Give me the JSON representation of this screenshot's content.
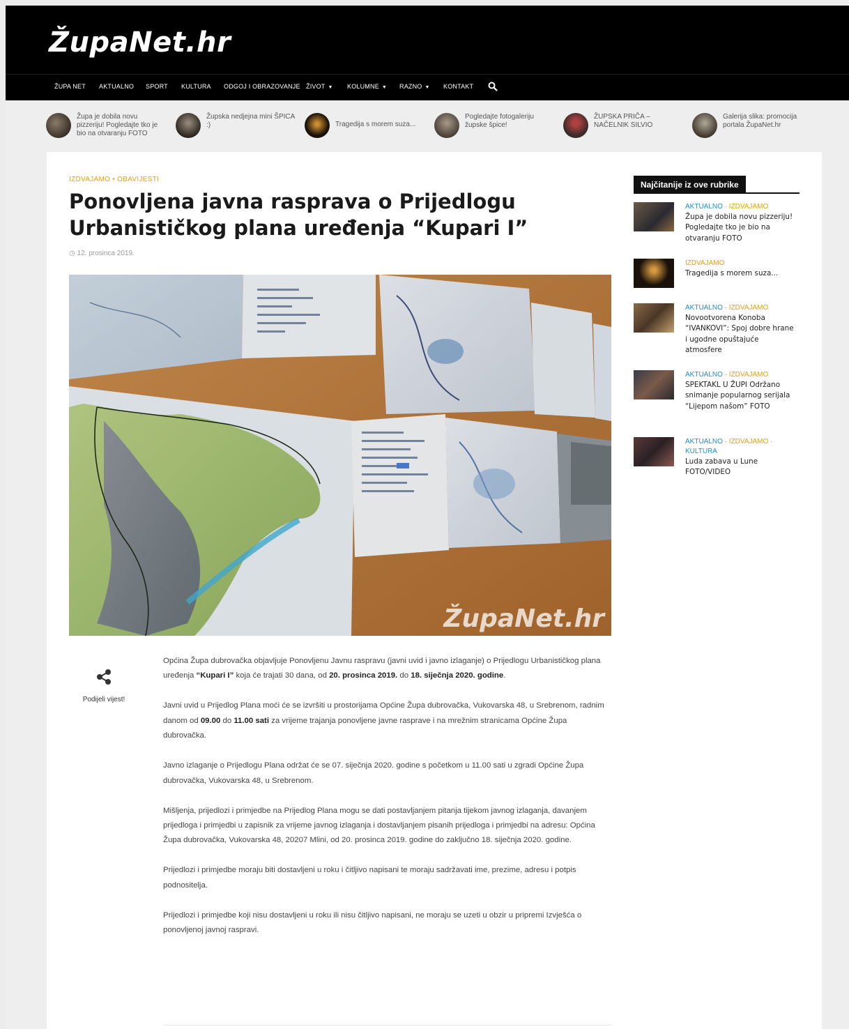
{
  "site": {
    "logo": "ŽupaNet.hr"
  },
  "nav": {
    "items": [
      {
        "label": "ŽUPA NET"
      },
      {
        "label": "AKTUALNO"
      },
      {
        "label": "SPORT"
      },
      {
        "label": "KULTURA"
      },
      {
        "label": "ODGOJ I OBRAZOVANJE"
      },
      {
        "label": "ŽIVOT"
      },
      {
        "label": "KOLUMNE"
      },
      {
        "label": "RAZNO"
      },
      {
        "label": "KONTAKT"
      }
    ]
  },
  "ticker": [
    {
      "text": "Župa je dobila novu pizzeriju! Pogledajte tko je bio na otvaranju FOTO"
    },
    {
      "text": "Župska nedjejna mini ŠPICA :)"
    },
    {
      "text": "Tragedija s morem suza..."
    },
    {
      "text": "Pogledajte fotogaleriju župske špice!"
    },
    {
      "text": "ŽUPSKA PRIČA – NAČELNIK SILVIO"
    },
    {
      "text": "Galerija slika: promocija portala ŽupaNet.hr"
    }
  ],
  "article": {
    "categories": "IZDVAJAMO • OBAVIJESTI",
    "title": "Ponovljena javna rasprava o Prijedlogu Urbanističkog plana uređenja “Kupari I”",
    "date": "12. prosinca 2019.",
    "watermark": "ŽupaNet.hr",
    "share_label": "Podijeli vijest!",
    "p1": {
      "a": "Općina Župa dubrovačka objavljuje Ponovljenu Javnu raspravu (javni uvid i javno izlaganje) o Prijedlogu Urbanističkog plana uređenja ",
      "b": "“Kupari I”",
      "c": " koja će trajati 30 dana, od ",
      "d": "20. prosinca 2019.",
      "e": " do ",
      "f": "18. siječnja 2020. godine",
      "g": "."
    },
    "p2": {
      "a": "Javni uvid u Prijedlog Plana moći će se izvršiti u prostorijama Općine Župa dubrovačka, Vukovarska 48, u Srebrenom, radnim danom od ",
      "b": "09.00",
      "c": " do ",
      "d": "11.00 sati",
      "e": " za vrijeme trajanja ponovljene javne rasprave i na mrežnim stranicama Općine Župa dubrovačka."
    },
    "p3": "Javno izlaganje o Prijedlogu Plana održat će se 07. siječnja 2020. godine s početkom u 11.00 sati u zgradi Općine Župa dubrovačka, Vukovarska 48, u Srebrenom.",
    "p4": "Mišljenja, prijedlozi i primjedbe na Prijedlog Plana mogu se dati postavljanjem pitanja tijekom javnog izlaganja, davanjem prijedloga i primjedbi u zapisnik za vrijeme javnog izlaganja i dostavljanjem pisanih prijedloga i primjedbi na adresu: Općina Župa dubrovačka, Vukovarska 48, 20207 Mlini, od 20. prosinca 2019. godine do zaključno 18. siječnja 2020. godine.",
    "p5": "Prijedlozi i primjedbe moraju biti dostavljeni u roku i čitljivo napisani te moraju sadržavati ime, prezime, adresu i potpis podnositelja.",
    "p6": "Prijedlozi i primjedbe koji nisu dostavljeni u roku ili nisu čitljivo napisani, ne moraju se uzeti u obzir u pripremi Izvješća o ponovljenoj javnoj raspravi."
  },
  "sidebar": {
    "heading": "Najčitanije iz ove rubrike",
    "items": [
      {
        "cat1": "AKTUALNO",
        "cat2": "IZDVAJAMO",
        "cat3": "",
        "title": "Župa je dobila novu pizzeriju! Pogledajte tko je bio na otvaranju FOTO"
      },
      {
        "cat1": "",
        "cat2": "IZDVAJAMO",
        "cat3": "",
        "title": "Tragedija s morem suza..."
      },
      {
        "cat1": "AKTUALNO",
        "cat2": "IZDVAJAMO",
        "cat3": "",
        "title": "Novootvorena Konoba “IVANKOVI”: Spoj dobre hrane i ugodne opuštajuće atmosfere"
      },
      {
        "cat1": "AKTUALNO",
        "cat2": "IZDVAJAMO",
        "cat3": "",
        "title": "SPEKTAKL U ŽUPI Održano snimanje popularnog serijala “Lijepom našom” FOTO"
      },
      {
        "cat1": "AKTUALNO",
        "cat2": "IZDVAJAMO",
        "cat3": "KULTURA",
        "title": "Luda zabava u Lune FOTO/VIDEO"
      }
    ]
  },
  "colors": {
    "accent": "#e8a100",
    "link_blue": "#1a8fd0",
    "header_bg": "#000000"
  },
  "icons": {
    "search": "search-icon",
    "share": "share-icon",
    "clock": "clock-icon",
    "caret": "caret-down-icon"
  }
}
